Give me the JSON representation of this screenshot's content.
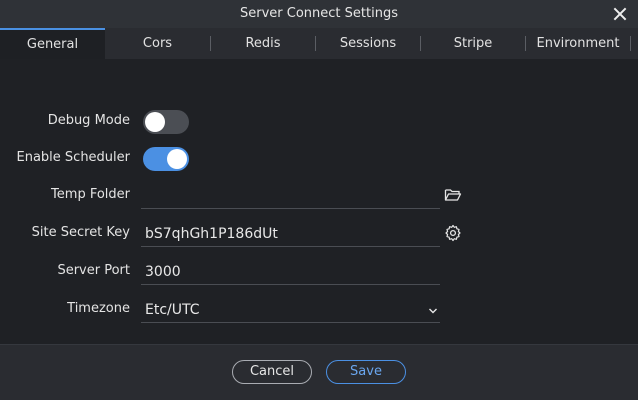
{
  "window": {
    "title": "Server Connect Settings"
  },
  "tabs": [
    {
      "label": "General"
    },
    {
      "label": "Cors"
    },
    {
      "label": "Redis"
    },
    {
      "label": "Sessions"
    },
    {
      "label": "Stripe"
    },
    {
      "label": "Environment"
    }
  ],
  "active_tab": "General",
  "form": {
    "debug_mode": {
      "label": "Debug Mode",
      "enabled": false
    },
    "enable_scheduler": {
      "label": "Enable Scheduler",
      "enabled": true
    },
    "temp_folder": {
      "label": "Temp Folder",
      "value": "",
      "icon": "folder-open-icon"
    },
    "site_secret_key": {
      "label": "Site Secret Key",
      "value": "bS7qhGh1P186dUt",
      "icon": "gear-icon"
    },
    "server_port": {
      "label": "Server Port",
      "value": "3000"
    },
    "timezone": {
      "label": "Timezone",
      "value": "Etc/UTC"
    }
  },
  "footer": {
    "cancel_label": "Cancel",
    "save_label": "Save"
  },
  "colors": {
    "accent": "#4b90e3",
    "background": "#1f2125"
  }
}
